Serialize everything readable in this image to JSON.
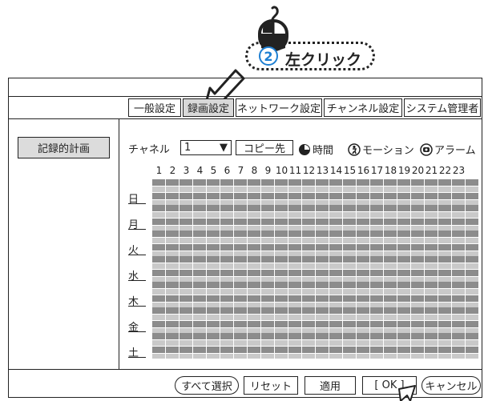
{
  "callout": {
    "step": "2",
    "text": "左クリック"
  },
  "tabs": [
    {
      "label": "一般設定",
      "active": false
    },
    {
      "label": "録画設定",
      "active": true
    },
    {
      "label": "ネットワーク設定",
      "active": false
    },
    {
      "label": "チャンネル設定",
      "active": false
    },
    {
      "label": "システム管理者",
      "active": false
    }
  ],
  "sidebar": {
    "item": "記録的計画"
  },
  "channel": {
    "label": "チャネル",
    "value": "1",
    "arrow": "▼",
    "copy": "コピー先"
  },
  "legend": [
    {
      "icon": "clock-icon",
      "label": "時間"
    },
    {
      "icon": "motion-icon",
      "label": "モーション"
    },
    {
      "icon": "alarm-icon",
      "label": "アラーム"
    }
  ],
  "hours": [
    "1",
    "2",
    "3",
    "4",
    "5",
    "6",
    "7",
    "8",
    "9",
    "10",
    "11",
    "12",
    "13",
    "14",
    "15",
    "16",
    "17",
    "18",
    "19",
    "20",
    "21",
    "22",
    "23"
  ],
  "days": [
    "日",
    "月",
    "火",
    "水",
    "木",
    "金",
    "土"
  ],
  "footer": {
    "select_all": "すべて選択",
    "reset": "リセット",
    "apply": "適用",
    "ok": "[ OK ]",
    "cancel": "キャンセル"
  },
  "colors": {
    "cell_dark": "#8c8c8c",
    "cell_light": "#c9c9c9",
    "accent": "#1e7fd2"
  }
}
